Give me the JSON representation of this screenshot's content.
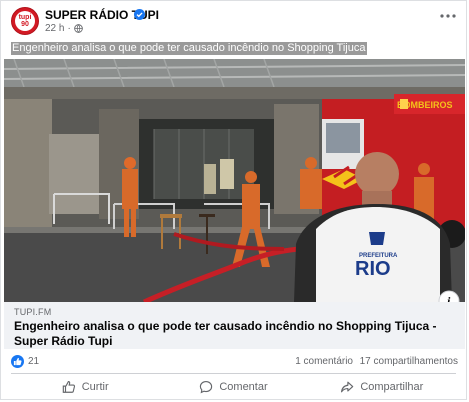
{
  "post": {
    "page_name": "SUPER RÁDIO TUPI",
    "avatar_text_top": "tupi",
    "avatar_text_bottom": "90",
    "time": "22 h",
    "caption": "Engenheiro analisa o que pode ter causado incêndio no Shopping Tijuca"
  },
  "photo": {
    "vest_text_top": "PREFEITURA",
    "vest_text_main": "RIO",
    "truck_text": "BOMBEIROS"
  },
  "link": {
    "domain": "TUPI.FM",
    "title": "Engenheiro analisa o que pode ter causado incêndio no Shopping Tijuca - Super Rádio Tupi",
    "info_icon": "i"
  },
  "stats": {
    "reactions": "21",
    "comments": "1 comentário",
    "shares": "17 compartilhamentos"
  },
  "actions": {
    "like": "Curtir",
    "comment": "Comentar",
    "share": "Compartilhar"
  },
  "colors": {
    "brand_red": "#d21a24",
    "facebook_blue": "#1877f2",
    "secondary_text": "#65676b"
  }
}
